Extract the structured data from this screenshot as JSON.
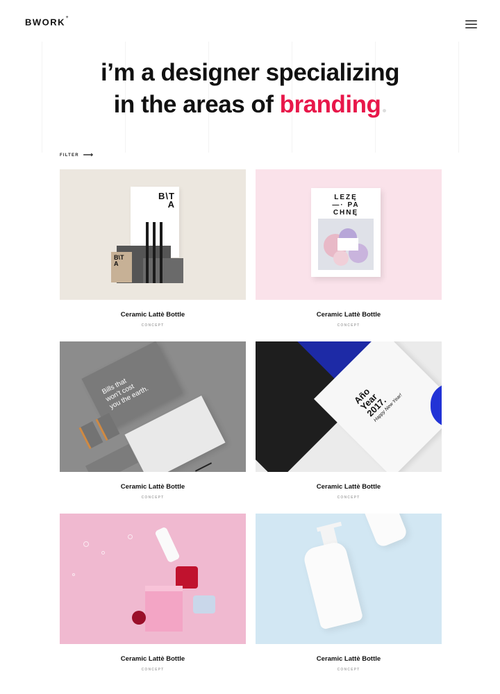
{
  "header": {
    "logo": "BWORK",
    "logo_mark": "°",
    "menu_icon": "hamburger-icon"
  },
  "hero": {
    "line1": "i’m a designer specializing",
    "line2_prefix": "in the areas of ",
    "line2_accent": "branding",
    "accent_color": "#e8174a"
  },
  "filter": {
    "label": "FILTER",
    "arrow": "⟶"
  },
  "portfolio": {
    "items": [
      {
        "title": "Ceramic Lattè Bottle",
        "category": "CONCEPT",
        "art_text": "B\\T\nA",
        "small_text": "B\\T\nA"
      },
      {
        "title": "Ceramic Lattè Bottle",
        "category": "CONCEPT",
        "art_text": "LEZĘ\n—· PA\nCHNĘ"
      },
      {
        "title": "Ceramic Lattè Bottle",
        "category": "CONCEPT",
        "art_text": "Bills that\nwon't cost\nyou the earth."
      },
      {
        "title": "Ceramic Lattè Bottle",
        "category": "CONCEPT",
        "art_text": "Año\nYear\n2017.",
        "art_sub": "Happy New Year!"
      },
      {
        "title": "Ceramic Lattè Bottle",
        "category": "CONCEPT"
      },
      {
        "title": "Ceramic Lattè Bottle",
        "category": "CONCEPT"
      }
    ]
  }
}
